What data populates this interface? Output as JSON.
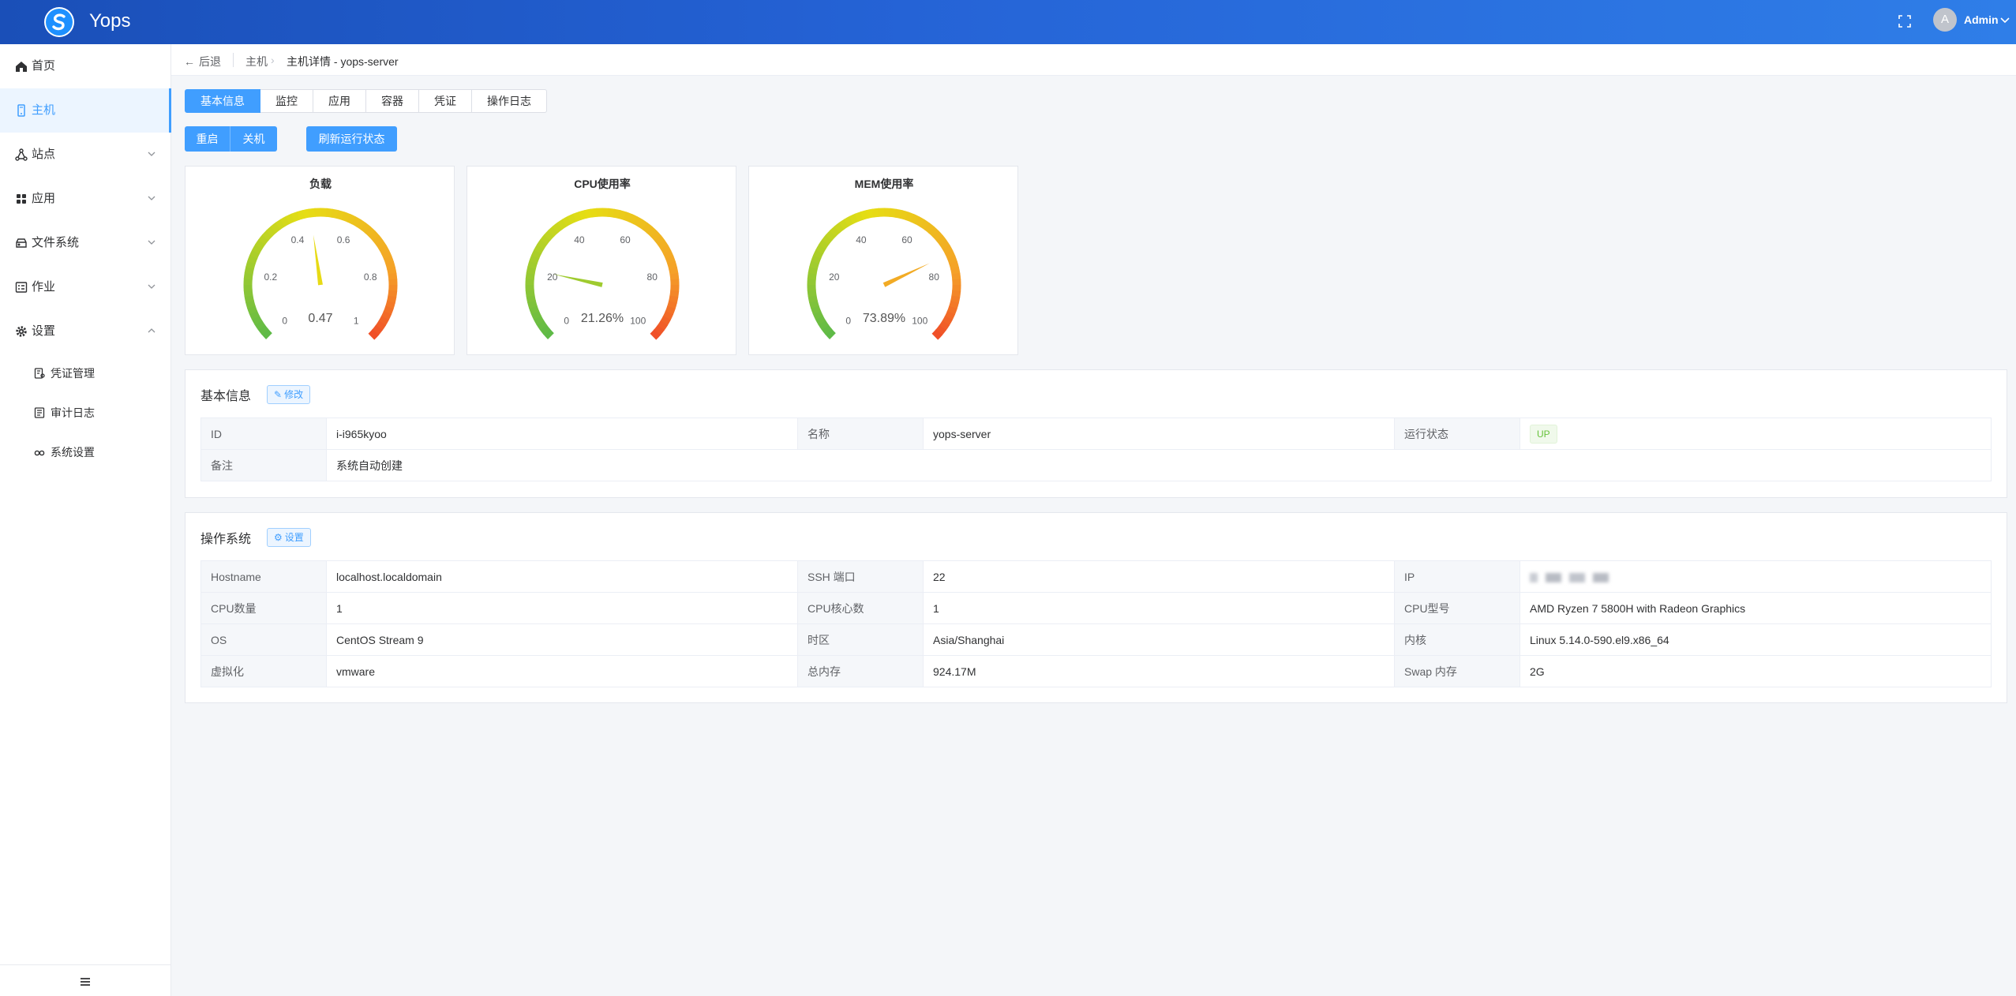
{
  "header": {
    "app_name": "Yops",
    "user": {
      "avatar_letter": "A",
      "name": "Admin"
    }
  },
  "sidebar": {
    "items": [
      {
        "label": "首页",
        "icon": "home-icon"
      },
      {
        "label": "主机",
        "icon": "server-icon",
        "active": true
      },
      {
        "label": "站点",
        "icon": "sitemap-icon"
      },
      {
        "label": "应用",
        "icon": "grid-icon"
      },
      {
        "label": "文件系统",
        "icon": "storage-icon"
      },
      {
        "label": "作业",
        "icon": "task-list-icon"
      },
      {
        "label": "设置",
        "icon": "gear-icon",
        "expanded": true
      }
    ],
    "sub_items": [
      {
        "label": "凭证管理",
        "icon": "credential-icon"
      },
      {
        "label": "审计日志",
        "icon": "log-icon"
      },
      {
        "label": "系统设置",
        "icon": "link-icon"
      }
    ]
  },
  "breadcrumb": {
    "back_label": "后退",
    "items": [
      "主机",
      "主机详情 - yops-server"
    ]
  },
  "tabs": [
    {
      "label": "基本信息",
      "active": true
    },
    {
      "label": "监控"
    },
    {
      "label": "应用"
    },
    {
      "label": "容器"
    },
    {
      "label": "凭证"
    },
    {
      "label": "操作日志"
    }
  ],
  "actions": {
    "restart_label": "重启",
    "shutdown_label": "关机",
    "refresh_label": "刷新运行状态"
  },
  "gauges": [
    {
      "title": "负载",
      "value": 0.47,
      "display": "0.47",
      "min": 0,
      "max": 1,
      "ticks": [
        "0",
        "0.2",
        "0.4",
        "0.6",
        "0.8",
        "1"
      ]
    },
    {
      "title": "CPU使用率",
      "value": 21.26,
      "display": "21.26%",
      "min": 0,
      "max": 100,
      "ticks": [
        "0",
        "20",
        "40",
        "60",
        "80",
        "100"
      ]
    },
    {
      "title": "MEM使用率",
      "value": 73.89,
      "display": "73.89%",
      "min": 0,
      "max": 100,
      "ticks": [
        "0",
        "20",
        "40",
        "60",
        "80",
        "100"
      ]
    }
  ],
  "basic_info": {
    "title": "基本信息",
    "edit_label": "修改",
    "rows": [
      [
        {
          "label": "ID",
          "value": "i-i965kyoo"
        },
        {
          "label": "名称",
          "value": "yops-server"
        },
        {
          "label": "运行状态",
          "value": "UP",
          "tag": true
        }
      ],
      [
        {
          "label": "备注",
          "value": "系统自动创建"
        }
      ]
    ]
  },
  "os_info": {
    "title": "操作系统",
    "settings_label": "设置",
    "rows": [
      [
        {
          "label": "Hostname",
          "value": "localhost.localdomain"
        },
        {
          "label": "SSH 端口",
          "value": "22"
        },
        {
          "label": "IP",
          "value": "",
          "blurred": true
        }
      ],
      [
        {
          "label": "CPU数量",
          "value": "1"
        },
        {
          "label": "CPU核心数",
          "value": "1"
        },
        {
          "label": "CPU型号",
          "value": "AMD Ryzen 7 5800H with Radeon Graphics"
        }
      ],
      [
        {
          "label": "OS",
          "value": "CentOS Stream 9"
        },
        {
          "label": "时区",
          "value": "Asia/Shanghai"
        },
        {
          "label": "内核",
          "value": "Linux 5.14.0-590.el9.x86_64"
        }
      ],
      [
        {
          "label": "虚拟化",
          "value": "vmware"
        },
        {
          "label": "总内存",
          "value": "924.17M"
        },
        {
          "label": "Swap 内存",
          "value": "2G"
        }
      ]
    ]
  },
  "colors": {
    "primary": "#409eff",
    "header_start": "#1a4fb8",
    "header_end": "#2f7ee8",
    "success": "#67c23a"
  }
}
